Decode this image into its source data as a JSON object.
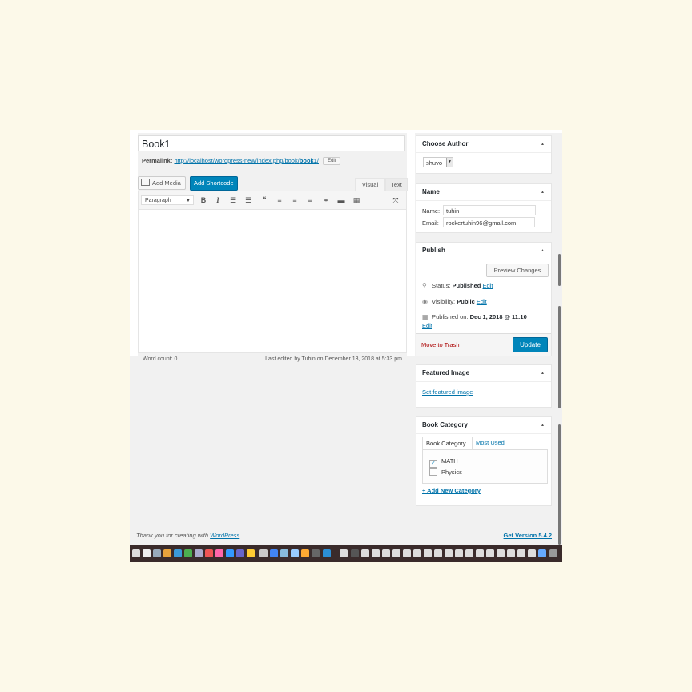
{
  "editor": {
    "title": "Book1",
    "permalink_label": "Permalink:",
    "permalink_url": "http://localhost/wordpress-new/index.php/book/",
    "permalink_slug": "book1",
    "permalink_trailing": "/",
    "permalink_edit": "Edit",
    "add_media": "Add Media",
    "add_shortcode": "Add Shortcode",
    "tab_visual": "Visual",
    "tab_text": "Text",
    "format_select": "Paragraph",
    "toolbar_icons": [
      "bold-icon",
      "italic-icon",
      "bullet-list-icon",
      "numbered-list-icon",
      "blockquote-icon",
      "align-left-icon",
      "align-center-icon",
      "align-right-icon",
      "link-icon",
      "read-more-icon",
      "toolbar-toggle-icon",
      "fullscreen-icon"
    ],
    "word_count": "Word count: 0",
    "last_edited": "Last edited by Tuhin on December 13, 2018 at 5:33 pm"
  },
  "choose_author": {
    "title": "Choose Author",
    "selected": "shuvo"
  },
  "name_box": {
    "title": "Name",
    "name_label": "Name:",
    "name_value": "tuhin",
    "email_label": "Email:",
    "email_value": "rockertuhin96@gmail.com"
  },
  "publish": {
    "title": "Publish",
    "preview": "Preview Changes",
    "status_label": "Status:",
    "status_value": "Published",
    "visibility_label": "Visibility:",
    "visibility_value": "Public",
    "published_label": "Published on:",
    "published_value": "Dec 1, 2018 @ 11:10",
    "edit": "Edit",
    "trash": "Move to Trash",
    "update": "Update"
  },
  "featured_image": {
    "title": "Featured Image",
    "link": "Set featured image"
  },
  "book_category": {
    "title": "Book Category",
    "tab_all": "Book Category",
    "tab_most_used": "Most Used",
    "items": [
      {
        "label": "MATH",
        "checked": true
      },
      {
        "label": "Physics",
        "checked": false
      }
    ],
    "add_new": "+ Add New Category"
  },
  "footer": {
    "thanks_prefix": "Thank you for creating with ",
    "thanks_link": "WordPress",
    "thanks_suffix": ".",
    "version": "Get Version 5.4.2"
  },
  "colors": {
    "accent": "#0085ba",
    "link": "#0073aa",
    "page_bg": "#fcf9e9"
  }
}
